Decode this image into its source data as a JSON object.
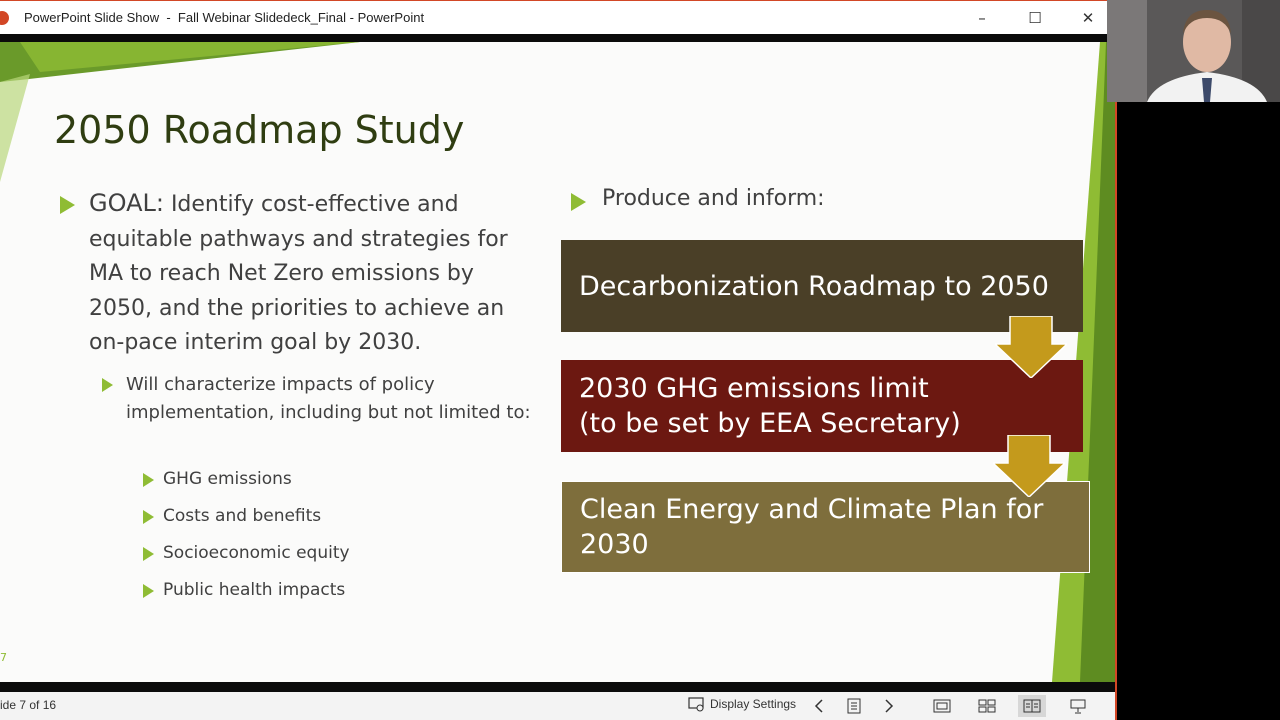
{
  "window": {
    "title": "PowerPoint Slide Show  -  Fall Webinar Slidedeck_Final - PowerPoint",
    "minimize": "–",
    "maximize": "☐",
    "close": "✕"
  },
  "slide": {
    "title": "2050 Roadmap Study",
    "goal_label": "GOAL:",
    "goal_text": " Identify cost-effective and equitable pathways and strategies for MA to reach Net Zero emissions by 2050, and the priorities to achieve an on-pace interim goal by 2030.",
    "sub_bullet": "Will characterize impacts of policy implementation, including but not limited to:",
    "impacts": [
      "GHG emissions",
      "Costs and benefits",
      "Socioeconomic equity",
      "Public health impacts"
    ],
    "produce_label": "Produce and inform:",
    "boxes": [
      {
        "text": "Decarbonization Roadmap to 2050",
        "color": "#4a3f27"
      },
      {
        "text": "2030 GHG emissions limit\n(to be set by EEA Secretary)",
        "color": "#6c1811"
      },
      {
        "text": "Clean Energy and Climate Plan for 2030",
        "color": "#7e6e3c"
      }
    ],
    "arrow_color": "#c49a1c",
    "accent_green": "#8fbc34",
    "slide_number": "7"
  },
  "statusbar": {
    "slide_counter": "ide 7 of 16",
    "display_settings": "Display Settings",
    "icons": [
      "display-settings-icon",
      "previous-icon",
      "slide-sorter-icon",
      "next-icon",
      "normal-view-icon",
      "grid-view-icon",
      "reading-view-icon",
      "slideshow-icon"
    ]
  }
}
